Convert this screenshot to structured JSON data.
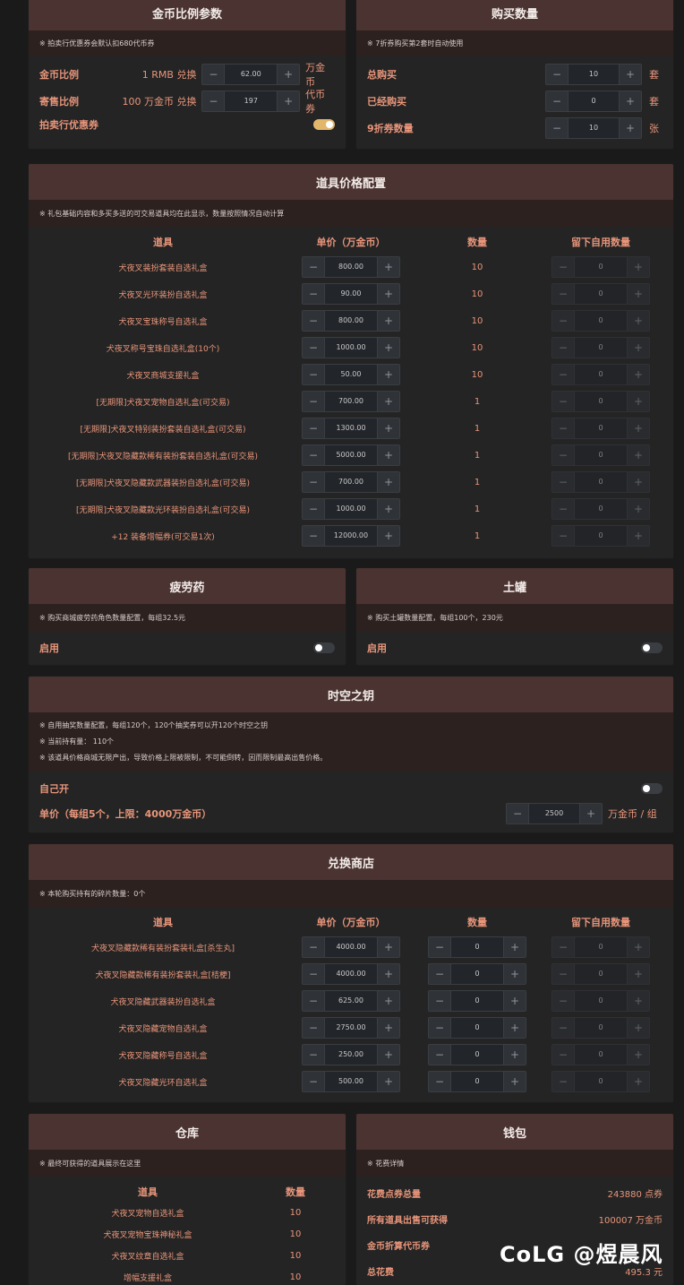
{
  "gold_ratio": {
    "title": "金币比例参数",
    "note": "※ 拍卖行优惠券会默认扣680代币券",
    "rows": [
      {
        "label": "金币比例",
        "prefix": "1 RMB 兑换",
        "value": "62.00",
        "unit": "万金币"
      },
      {
        "label": "寄售比例",
        "prefix": "100 万金币 兑换",
        "value": "197",
        "unit": "代币券"
      }
    ],
    "coupon_label": "拍卖行优惠券"
  },
  "purchase_qty": {
    "title": "购买数量",
    "note": "※ 7折券购买第2套时自动使用",
    "rows": [
      {
        "label": "总购买",
        "value": "10",
        "unit": "套"
      },
      {
        "label": "已经购买",
        "value": "0",
        "unit": "套"
      },
      {
        "label": "9折券数量",
        "value": "10",
        "unit": "张"
      }
    ]
  },
  "item_price": {
    "title": "道具价格配置",
    "note": "※ 礼包基础内容和多买多送的可交易道具均在此显示，数量按照情况自动计算",
    "headers": [
      "道具",
      "单价（万金币）",
      "数量",
      "留下自用数量"
    ],
    "rows": [
      {
        "name": "犬夜叉装扮套装自选礼盒",
        "price": "800.00",
        "qty": "10",
        "keep": "0"
      },
      {
        "name": "犬夜叉光环装扮自选礼盒",
        "price": "90.00",
        "qty": "10",
        "keep": "0"
      },
      {
        "name": "犬夜叉宝珠称号自选礼盒",
        "price": "800.00",
        "qty": "10",
        "keep": "0"
      },
      {
        "name": "犬夜叉称号宝珠自选礼盒(10个)",
        "price": "1000.00",
        "qty": "10",
        "keep": "0"
      },
      {
        "name": "犬夜叉商城支援礼盒",
        "price": "50.00",
        "qty": "10",
        "keep": "0"
      },
      {
        "name": "[无期限]犬夜叉宠物自选礼盒(可交易)",
        "price": "700.00",
        "qty": "1",
        "keep": "0"
      },
      {
        "name": "[无期限]犬夜叉特别装扮套装自选礼盒(可交易)",
        "price": "1300.00",
        "qty": "1",
        "keep": "0"
      },
      {
        "name": "[无期限]犬夜叉隐藏款稀有装扮套装自选礼盒(可交易)",
        "price": "5000.00",
        "qty": "1",
        "keep": "0"
      },
      {
        "name": "[无期限]犬夜叉隐藏款武器装扮自选礼盒(可交易)",
        "price": "700.00",
        "qty": "1",
        "keep": "0"
      },
      {
        "name": "[无期限]犬夜叉隐藏款光环装扮自选礼盒(可交易)",
        "price": "1000.00",
        "qty": "1",
        "keep": "0"
      },
      {
        "name": "+12 装备增幅券(可交易1次)",
        "price": "12000.00",
        "qty": "1",
        "keep": "0"
      }
    ]
  },
  "fatigue": {
    "title": "疲劳药",
    "note": "※ 购买商城疲劳药角色数量配置，每组32.5元",
    "label": "启用"
  },
  "jar": {
    "title": "土罐",
    "note": "※ 购买土罐数量配置，每组100个，230元",
    "label": "启用"
  },
  "time_key": {
    "title": "时空之钥",
    "notes": [
      "※ 自用抽奖数量配置，每组120个，120个抽奖券可以开120个时空之钥",
      "※ 当前持有量： 110个",
      "※ 该道具价格商城无限产出，导致价格上限被限制，不可能倒转，因而限制最高出售价格。"
    ],
    "self_open": "自己开",
    "price_label": "单价（每组5个，上限：4000万金币）",
    "price_value": "2500",
    "price_unit": "万金币 / 组"
  },
  "exchange": {
    "title": "兑换商店",
    "note": "※ 本轮购买持有的碎片数量：0个",
    "headers": [
      "道具",
      "单价（万金币）",
      "数量",
      "留下自用数量"
    ],
    "rows": [
      {
        "name": "犬夜叉隐藏款稀有装扮套装礼盒[杀生丸]",
        "price": "4000.00",
        "qty": "0",
        "keep": "0"
      },
      {
        "name": "犬夜叉隐藏款稀有装扮套装礼盒[桔梗]",
        "price": "4000.00",
        "qty": "0",
        "keep": "0"
      },
      {
        "name": "犬夜叉隐藏武器装扮自选礼盒",
        "price": "625.00",
        "qty": "0",
        "keep": "0"
      },
      {
        "name": "犬夜叉隐藏宠物自选礼盒",
        "price": "2750.00",
        "qty": "0",
        "keep": "0"
      },
      {
        "name": "犬夜叉隐藏称号自选礼盒",
        "price": "250.00",
        "qty": "0",
        "keep": "0"
      },
      {
        "name": "犬夜叉隐藏光环自选礼盒",
        "price": "500.00",
        "qty": "0",
        "keep": "0"
      }
    ]
  },
  "warehouse": {
    "title": "仓库",
    "note": "※ 最终可获得的道具展示在这里",
    "headers": [
      "道具",
      "数量"
    ],
    "rows": [
      {
        "name": "犬夜叉宠物自选礼盒",
        "qty": "10"
      },
      {
        "name": "犬夜叉宠物宝珠神秘礼盒",
        "qty": "10"
      },
      {
        "name": "犬夜叉纹章自选礼盒",
        "qty": "10"
      },
      {
        "name": "增幅支援礼盒",
        "qty": "10"
      }
    ]
  },
  "wallet": {
    "title": "钱包",
    "note": "※ 花费详情",
    "rows": [
      {
        "label": "花费点券总量",
        "value": "243880 点券"
      },
      {
        "label": "所有道具出售可获得",
        "value": "100007 万金币"
      },
      {
        "label": "金币折算代币券",
        "value": ""
      },
      {
        "label": "总花费",
        "value": "495.3 元"
      }
    ]
  },
  "watermark": "CoLG @煜晨风"
}
